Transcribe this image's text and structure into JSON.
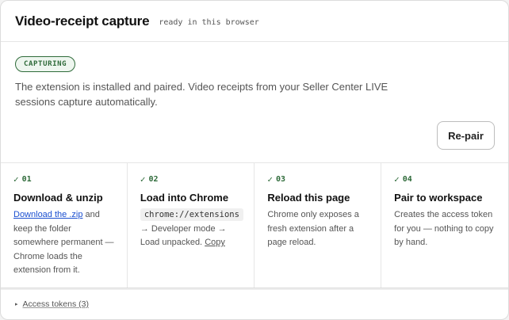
{
  "header": {
    "title": "Video-receipt capture",
    "subtitle": "ready in this browser"
  },
  "status": {
    "badge": "CAPTURING",
    "text": "The extension is installed and paired. Video receipts from your Seller Center LIVE sessions capture automatically.",
    "repair_label": "Re-pair"
  },
  "steps": [
    {
      "check": "✓",
      "num": "01",
      "title": "Download & unzip",
      "link": "Download the .zip",
      "body": " and keep the folder somewhere permanent — Chrome loads the extension from it."
    },
    {
      "check": "✓",
      "num": "02",
      "title": "Load into Chrome",
      "code": "chrome://extensions",
      "body": " → Developer mode → Load unpacked. ",
      "copy": "Copy"
    },
    {
      "check": "✓",
      "num": "03",
      "title": "Reload this page",
      "body": "Chrome only exposes a fresh extension after a page reload."
    },
    {
      "check": "✓",
      "num": "04",
      "title": "Pair to workspace",
      "body": "Creates the access token for you — nothing to copy by hand."
    }
  ],
  "footer": {
    "arrow": "▸",
    "label": "Access tokens (3)"
  },
  "colors": {
    "accent_green": "#2f6b3a",
    "link_blue": "#1a4fd0"
  }
}
